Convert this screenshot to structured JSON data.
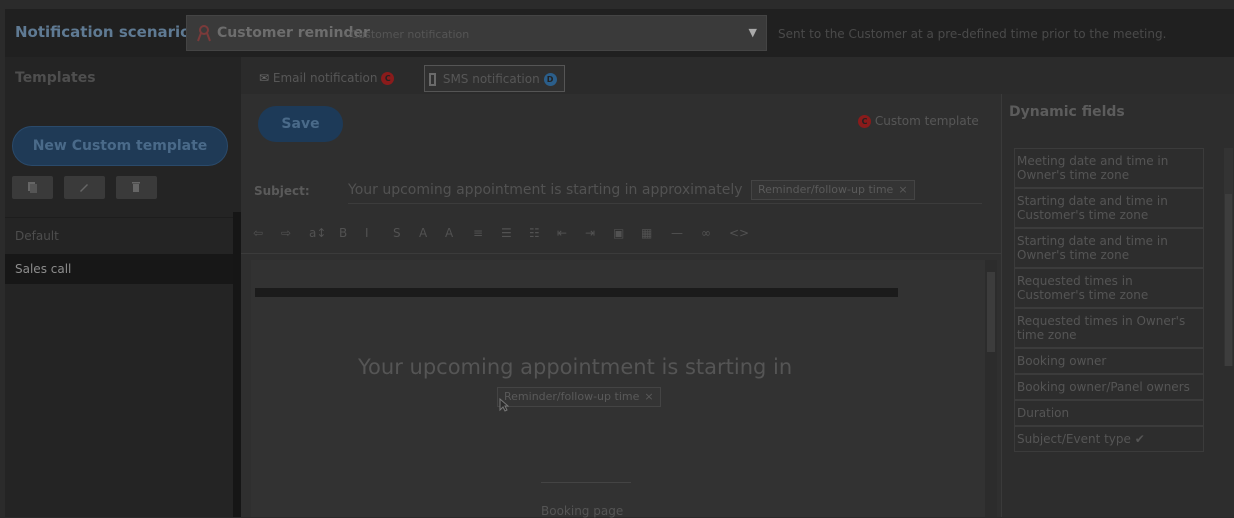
{
  "topbar": {
    "label": "Notification scenario:",
    "selected_name": "Customer reminder",
    "selected_sub": "- Customer notification",
    "description": "Sent to the Customer at a pre-defined time prior to the meeting."
  },
  "templates": {
    "title": "Templates",
    "new_button": "New Custom template",
    "items": [
      "Default",
      "Sales call"
    ],
    "selected": "Sales call"
  },
  "tabs": [
    {
      "label": "Email notification",
      "badge": "C"
    },
    {
      "label": "SMS notification",
      "badge": "D"
    }
  ],
  "editor": {
    "save_label": "Save",
    "custom_badge": "C",
    "custom_label": "Custom template",
    "subject_label": "Subject:",
    "subject_text": "Your upcoming appointment is starting in approximately",
    "subject_token": "Reminder/follow-up time",
    "token_close": "×",
    "body_heading": "Your upcoming appointment is starting in",
    "body_token": "Reminder/follow-up time",
    "booking_text": "Booking page"
  },
  "toolbar": {
    "items": [
      "undo-icon",
      "redo-icon",
      "font-size-icon",
      "bold-icon",
      "italic-icon",
      "strikethrough-icon",
      "font-color-icon",
      "background-color-icon",
      "align-icon",
      "bullet-list-icon",
      "numbered-list-icon",
      "outdent-icon",
      "indent-icon",
      "image-icon",
      "table-icon",
      "horizontal-rule-icon",
      "link-icon",
      "code-icon"
    ],
    "glyphs": [
      "⇦",
      "⇨",
      "a↕",
      "B",
      "I",
      "S",
      "A",
      "A",
      "≡",
      "☰",
      "☷",
      "⇤",
      "⇥",
      "▣",
      "▦",
      "—",
      "∞",
      "<>"
    ]
  },
  "dynamic_fields": {
    "title": "Dynamic fields",
    "items": [
      "Meeting date and time in Owner's time zone",
      "Starting date and time in Customer's time zone",
      "Starting date and time in Owner's time zone",
      "Requested times in Customer's time zone",
      "Requested times in Owner's time zone",
      "Booking owner",
      "Booking owner/Panel owners",
      "Duration",
      "Subject/Event type ✔"
    ]
  },
  "colors": {
    "brand_blue": "#1d3a58",
    "badge_red": "#8a1b1b",
    "badge_blue": "#2b5e8a",
    "overlay_dark": "#2b2b2b"
  }
}
